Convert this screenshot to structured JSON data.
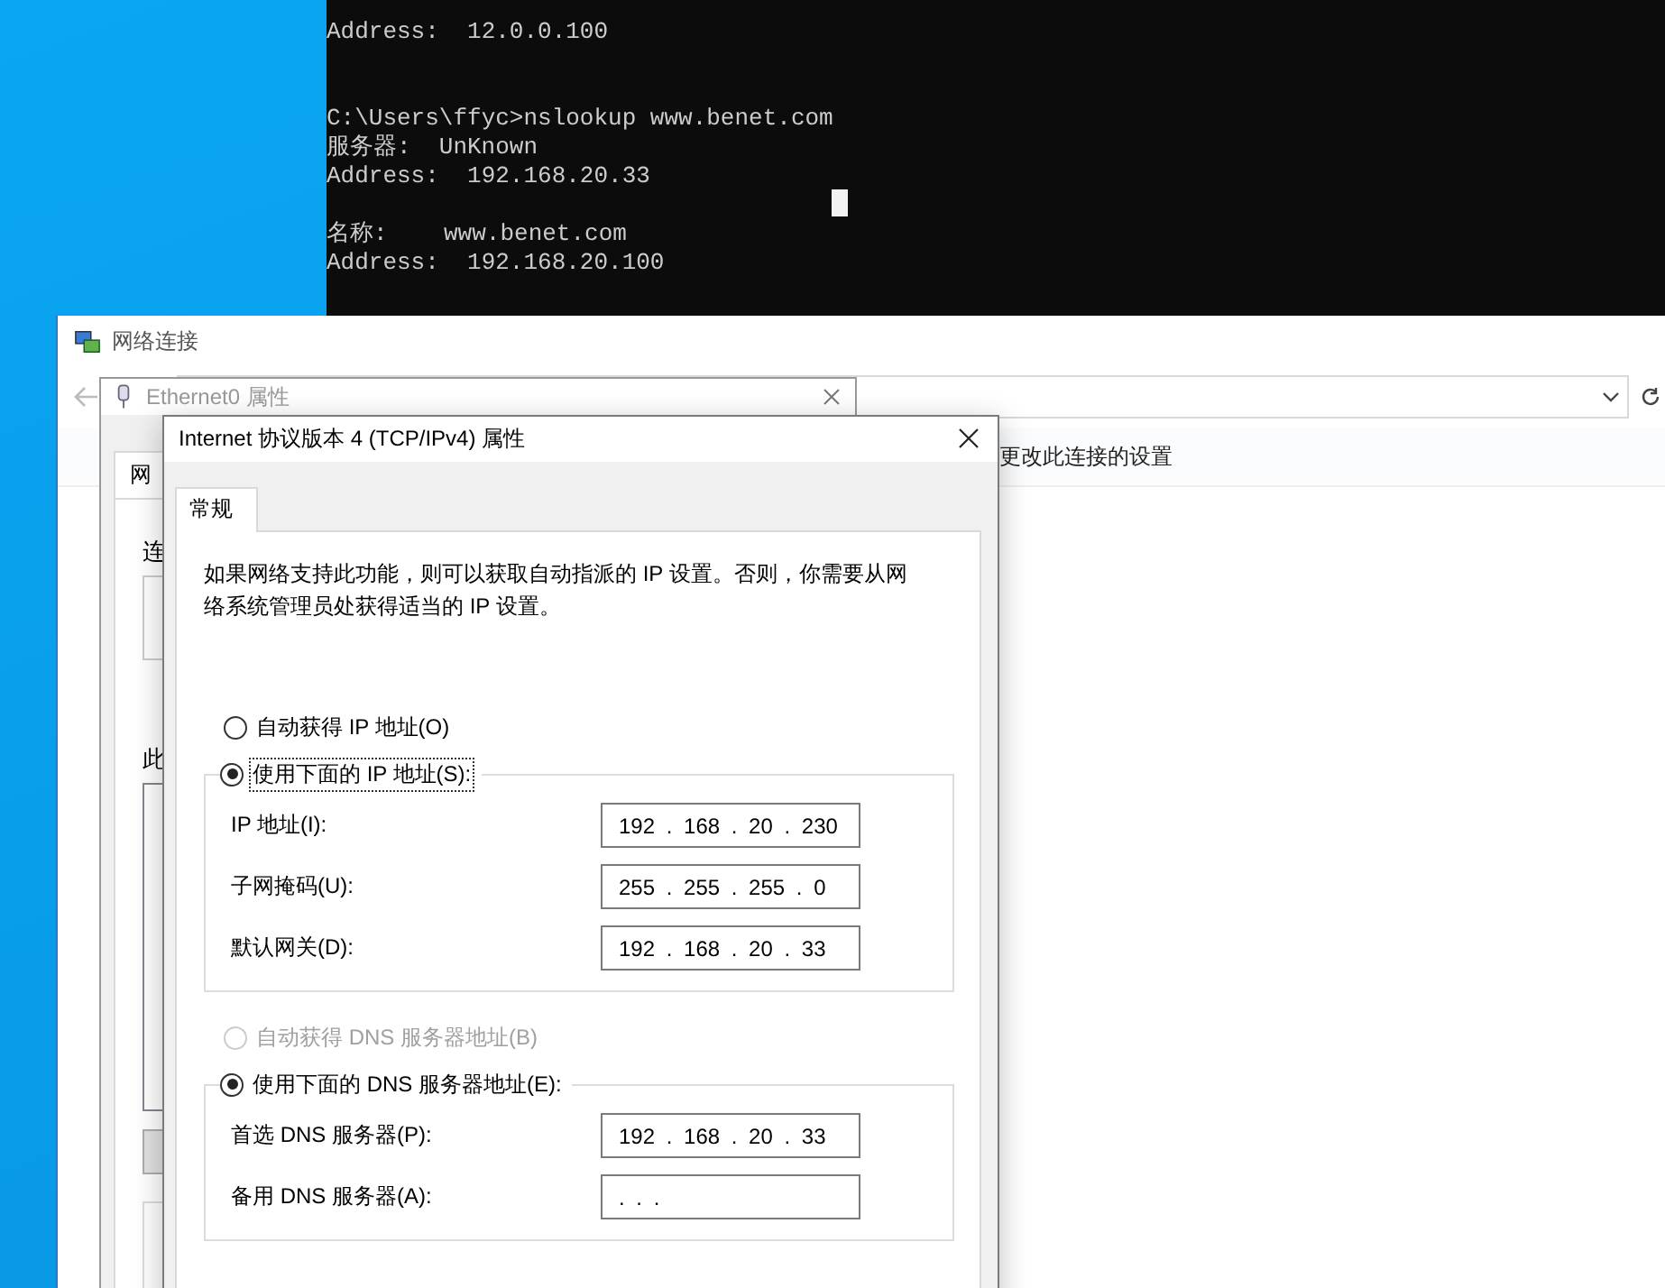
{
  "console": {
    "lines": [
      {
        "kind": "text",
        "text": "Address:  12.0.0.100"
      },
      {
        "kind": "blank"
      },
      {
        "kind": "blank"
      },
      {
        "kind": "text",
        "text": "C:\\Users\\ffyc>nslookup www.benet.com"
      },
      {
        "kind": "text",
        "text": "服务器:  UnKnown"
      },
      {
        "kind": "text",
        "text": "Address:  192.168.20.33"
      },
      {
        "kind": "blank"
      },
      {
        "kind": "text",
        "text": "名称:    www.benet.com"
      },
      {
        "kind": "text",
        "text": "Address:  192.168.20.100"
      }
    ]
  },
  "network_window": {
    "title": "网络连接",
    "toolbar": [
      "更改此连接的设置"
    ]
  },
  "ethernet_window": {
    "title": "Ethernet0 属性",
    "tabs": [
      {
        "label": "网",
        "selected": true
      }
    ],
    "labels": [
      "连",
      "此"
    ]
  },
  "dialog": {
    "title": "Internet 协议版本 4 (TCP/IPv4) 属性",
    "tabs": [
      {
        "label": "常规",
        "selected": true
      }
    ],
    "description": "如果网络支持此功能，则可以获取自动指派的 IP 设置。否则，你需要从网络系统管理员处获得适当的 IP 设置。",
    "ip_mode": [
      {
        "label": "自动获得 IP 地址(O)",
        "selected": false,
        "disabled": false,
        "focused": false
      },
      {
        "label": "使用下面的 IP 地址(S):",
        "selected": true,
        "disabled": false,
        "focused": true
      }
    ],
    "ip_fields": [
      {
        "label": "IP 地址(I):",
        "value": "192 . 168 . 20 . 230"
      },
      {
        "label": "子网掩码(U):",
        "value": "255 . 255 . 255 . 0"
      },
      {
        "label": "默认网关(D):",
        "value": "192 . 168 . 20 . 33"
      }
    ],
    "dns_mode": [
      {
        "label": "自动获得 DNS 服务器地址(B)",
        "selected": false,
        "disabled": true,
        "focused": false
      },
      {
        "label": "使用下面的 DNS 服务器地址(E):",
        "selected": true,
        "disabled": false,
        "focused": false
      }
    ],
    "dns_fields": [
      {
        "label": "首选 DNS 服务器(P):",
        "value": "192 . 168 . 20 . 33"
      },
      {
        "label": "备用 DNS 服务器(A):",
        "value": ". . ."
      }
    ]
  }
}
